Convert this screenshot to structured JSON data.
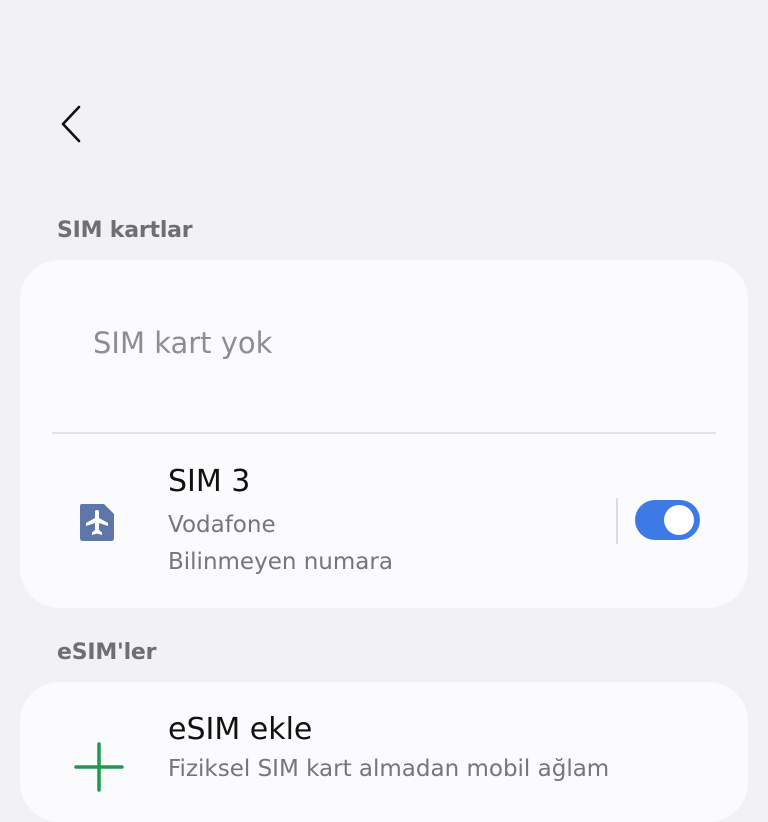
{
  "header": {
    "back_icon": "chevron-left-icon"
  },
  "sections": {
    "sim_cards_title": "SIM kartlar",
    "esims_title": "eSIM'ler"
  },
  "sim_card": {
    "no_sim_text": "SIM kart yok",
    "sim3": {
      "icon": "airplane-sim-icon",
      "title": "SIM 3",
      "carrier": "Vodafone",
      "number": "Bilinmeyen numara",
      "enabled": true
    }
  },
  "esim": {
    "add_icon": "plus-icon",
    "add_title": "eSIM ekle",
    "add_desc": "Fiziksel SIM kart almadan mobil ağlam"
  },
  "colors": {
    "accent": "#3d7ae6",
    "sim_icon": "#5e77a8",
    "plus_icon": "#1e9a4e",
    "background": "#f2f2f4",
    "card": "#fbfbfd"
  }
}
